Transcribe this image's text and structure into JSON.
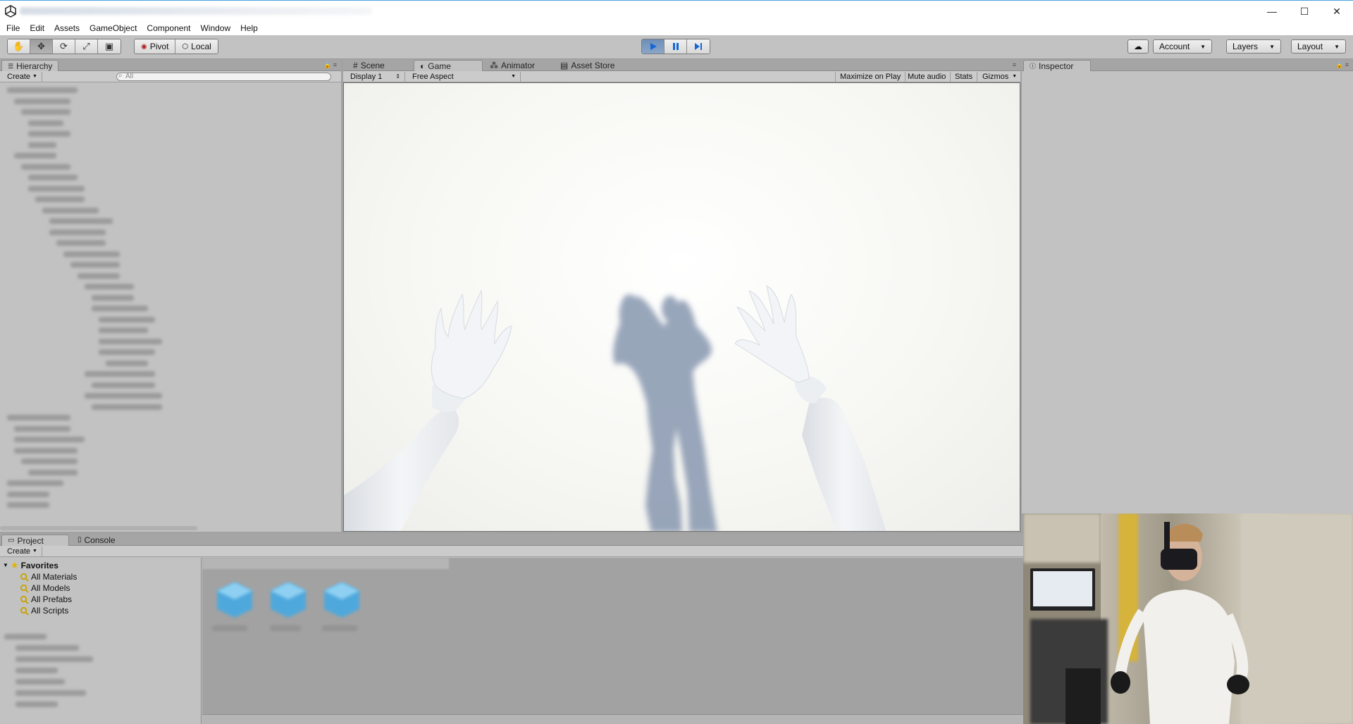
{
  "window": {
    "minimize": "—",
    "maximize": "☐",
    "close": "✕"
  },
  "menu": [
    "File",
    "Edit",
    "Assets",
    "GameObject",
    "Component",
    "Window",
    "Help"
  ],
  "toolbar": {
    "pivot_label": "Pivot",
    "local_label": "Local",
    "account_label": "Account",
    "layers_label": "Layers",
    "layout_label": "Layout"
  },
  "hierarchy": {
    "tab_label": "Hierarchy",
    "create_label": "Create",
    "search_placeholder": "All"
  },
  "center_tabs": [
    {
      "label": "Scene",
      "icon": "#"
    },
    {
      "label": "Game",
      "icon": "◐"
    },
    {
      "label": "Animator",
      "icon": "⁂"
    },
    {
      "label": "Asset Store",
      "icon": "▤"
    }
  ],
  "game": {
    "display": "Display 1",
    "aspect": "Free Aspect",
    "maximize_on_play": "Maximize on Play",
    "mute_audio": "Mute audio",
    "stats": "Stats",
    "gizmos": "Gizmos"
  },
  "inspector": {
    "tab_label": "Inspector"
  },
  "project": {
    "tab_label": "Project",
    "console_label": "Console",
    "create_label": "Create",
    "favorites_label": "Favorites",
    "favorites": [
      "All Materials",
      "All Models",
      "All Prefabs",
      "All Scripts"
    ]
  },
  "colors": {
    "accent_blue": "#1566d6",
    "panel_bg": "#c2c2c2",
    "dark_bg": "#a2a2a2"
  }
}
